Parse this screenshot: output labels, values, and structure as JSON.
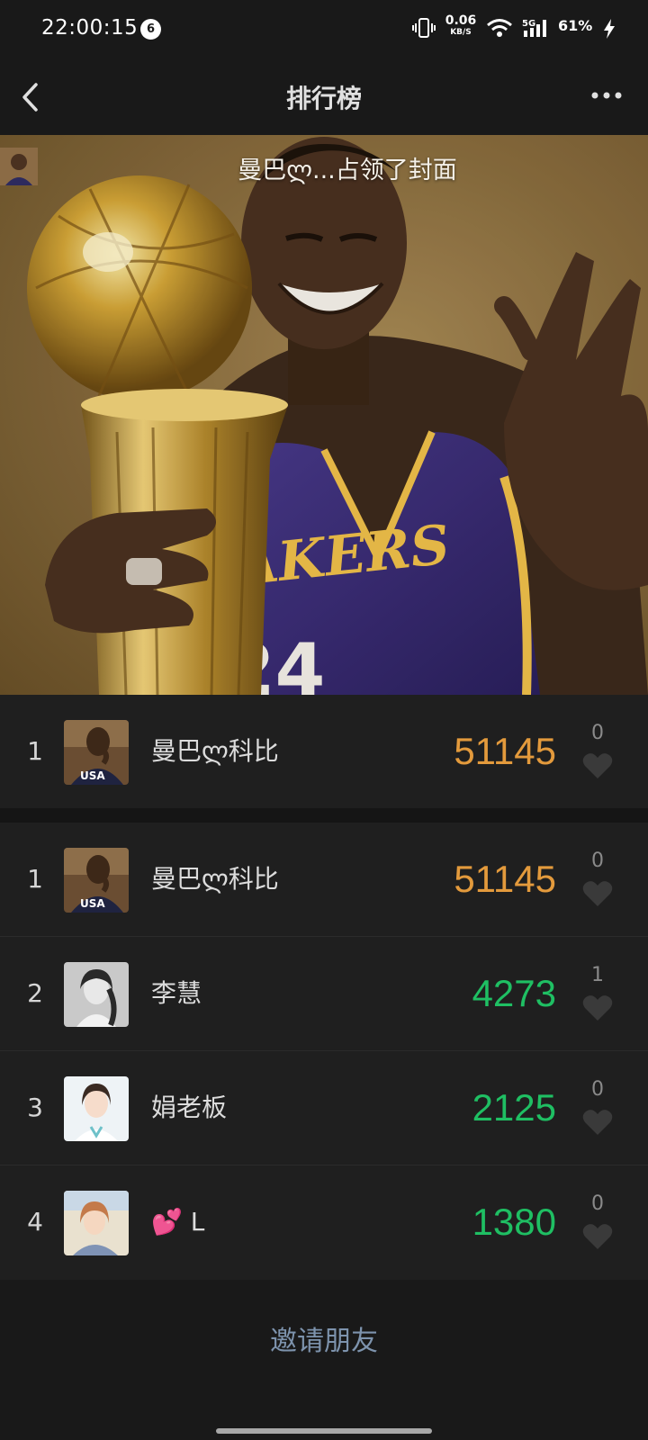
{
  "status_bar": {
    "time": "22:00:15",
    "notification_count": "6",
    "net_speed_value": "0.06",
    "net_speed_unit": "KB/S",
    "network_type": "5G",
    "battery": "61%"
  },
  "header": {
    "title": "排行榜"
  },
  "cover": {
    "caption": "曼巴ლ...占领了封面"
  },
  "my_rank": {
    "rank": "1",
    "name": "曼巴ლ科比",
    "steps": "51145",
    "likes": "0"
  },
  "ranking": [
    {
      "rank": "1",
      "name": "曼巴ლ科比",
      "steps": "51145",
      "likes": "0",
      "color": "#e39a3c"
    },
    {
      "rank": "2",
      "name": "李慧",
      "steps": "4273",
      "likes": "1",
      "color": "#1fbf63"
    },
    {
      "rank": "3",
      "name": "娟老板",
      "steps": "2125",
      "likes": "0",
      "color": "#1fbf63"
    },
    {
      "rank": "4",
      "name": "💕 L",
      "steps": "1380",
      "likes": "0",
      "color": "#1fbf63"
    }
  ],
  "invite_label": "邀请朋友",
  "colors": {
    "background": "#191919",
    "row": "#1f1f1f",
    "first_place": "#e39a3c",
    "others": "#1fbf63",
    "link": "#7d93ad"
  }
}
